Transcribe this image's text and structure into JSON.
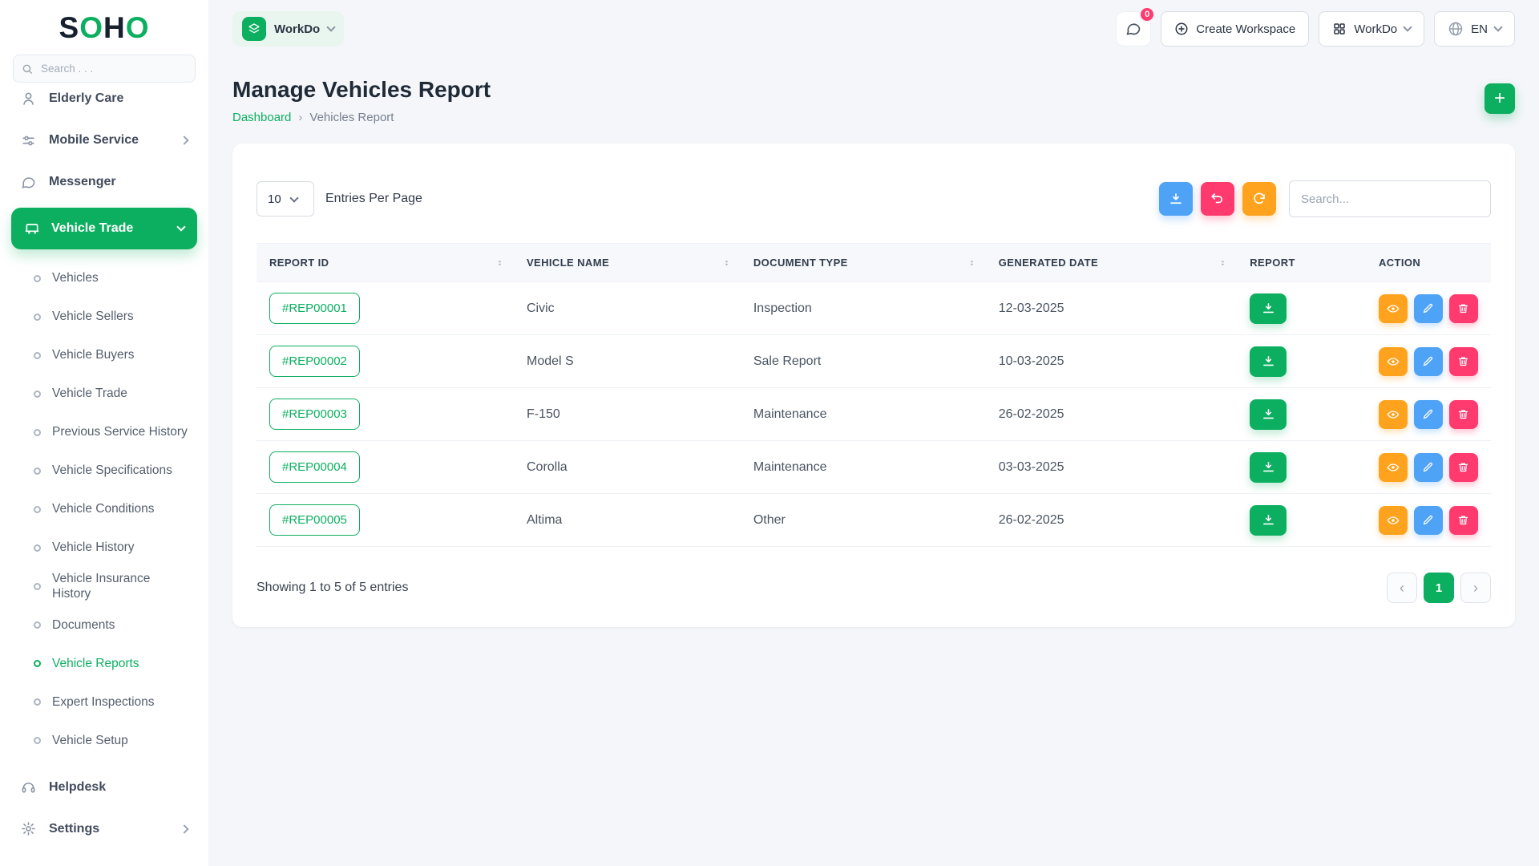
{
  "brand": {
    "letters": [
      "S",
      "O",
      "H",
      "O"
    ]
  },
  "icons": {
    "plus": "+",
    "prev": "‹",
    "next": "›",
    "crumb_sep": "›"
  },
  "sidebar": {
    "search_placeholder": "Search . . .",
    "items_top": [
      {
        "label": "Elderly Care"
      },
      {
        "label": "Mobile Service"
      },
      {
        "label": "Messenger"
      }
    ],
    "active_item": {
      "label": "Vehicle Trade"
    },
    "submenu": [
      "Vehicles",
      "Vehicle Sellers",
      "Vehicle Buyers",
      "Vehicle Trade",
      "Previous Service History",
      "Vehicle Specifications",
      "Vehicle Conditions",
      "Vehicle History",
      "Vehicle Insurance History",
      "Documents",
      "Vehicle Reports",
      "Expert Inspections",
      "Vehicle Setup"
    ],
    "active_submenu": "Vehicle Reports",
    "items_bottom": [
      {
        "label": "Helpdesk"
      },
      {
        "label": "Settings"
      }
    ]
  },
  "header": {
    "workspace_pill_label": "WorkDo",
    "chat_badge": "0",
    "create_workspace_label": "Create Workspace",
    "workdo_menu_label": "WorkDo",
    "language": "EN"
  },
  "page": {
    "title": "Manage Vehicles Report",
    "breadcrumb": {
      "home": "Dashboard",
      "current": "Vehicles Report"
    }
  },
  "toolbar": {
    "entries_value": "10",
    "entries_label": "Entries Per Page",
    "search_placeholder": "Search..."
  },
  "table": {
    "headers": [
      "REPORT ID",
      "VEHICLE NAME",
      "DOCUMENT TYPE",
      "GENERATED DATE",
      "REPORT",
      "ACTION"
    ],
    "rows": [
      {
        "id": "#REP00001",
        "vehicle": "Civic",
        "doc_type": "Inspection",
        "date": "12-03-2025"
      },
      {
        "id": "#REP00002",
        "vehicle": "Model S",
        "doc_type": "Sale Report",
        "date": "10-03-2025"
      },
      {
        "id": "#REP00003",
        "vehicle": "F-150",
        "doc_type": "Maintenance",
        "date": "26-02-2025"
      },
      {
        "id": "#REP00004",
        "vehicle": "Corolla",
        "doc_type": "Maintenance",
        "date": "03-03-2025"
      },
      {
        "id": "#REP00005",
        "vehicle": "Altima",
        "doc_type": "Other",
        "date": "26-02-2025"
      }
    ]
  },
  "footer": {
    "showing_text": "Showing 1 to 5 of 5 entries",
    "page_number": "1"
  },
  "colors": {
    "primary": "#0caf60",
    "info": "#4fa3f7",
    "warning": "#ffa21d",
    "danger": "#ff3a6e"
  }
}
